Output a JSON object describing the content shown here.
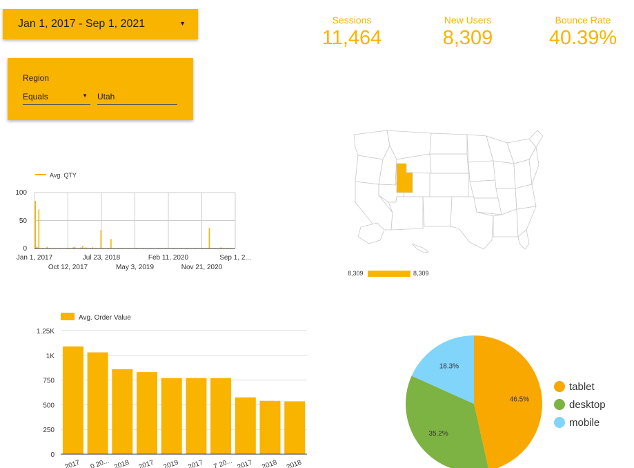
{
  "date_range": {
    "label": "Jan 1, 2017 - Sep 1, 2021",
    "caret_icon": "dropdown-caret-icon"
  },
  "filter": {
    "field_label": "Region",
    "operator": "Equals",
    "value": "Utah"
  },
  "kpis": {
    "sessions": {
      "label": "Sessions",
      "value": "11,464"
    },
    "new_users": {
      "label": "New Users",
      "value": "8,309"
    },
    "bounce_rate": {
      "label": "Bounce Rate",
      "value": "40.39%"
    }
  },
  "colors": {
    "accent": "#f9b400",
    "pie_desktop": "#7cb342",
    "pie_mobile": "#81d4fa",
    "map_fill": "#ffffff"
  },
  "map": {
    "highlighted_region": "Utah",
    "legend_min": "8,309",
    "legend_max": "8,309"
  },
  "chart_data": [
    {
      "type": "bar",
      "legend": "Avg. QTY",
      "xlabels_top": [
        "Jan 1, 2017",
        "Jul 23, 2018",
        "Feb 11, 2020",
        "Sep 1, 2..."
      ],
      "xlabels_bottom": [
        "Oct 12, 2017",
        "May 3, 2019",
        "Nov 21, 2020"
      ],
      "yticks": [
        "0",
        "50",
        "100"
      ],
      "ylim": [
        0,
        100
      ],
      "x_range": [
        "2017-01-01",
        "2021-09-01"
      ],
      "points": [
        {
          "x": "2017-01-04",
          "y": 85
        },
        {
          "x": "2017-01-09",
          "y": 3
        },
        {
          "x": "2017-01-20",
          "y": 2
        },
        {
          "x": "2017-02-02",
          "y": 70
        },
        {
          "x": "2017-03-04",
          "y": 1
        },
        {
          "x": "2017-04-14",
          "y": 3
        },
        {
          "x": "2017-05-04",
          "y": 1
        },
        {
          "x": "2017-06-16",
          "y": 1
        },
        {
          "x": "2017-07-31",
          "y": 1
        },
        {
          "x": "2017-09-04",
          "y": 1
        },
        {
          "x": "2017-09-30",
          "y": 1
        },
        {
          "x": "2017-10-16",
          "y": 1
        },
        {
          "x": "2017-11-22",
          "y": 2
        },
        {
          "x": "2017-12-04",
          "y": 3
        },
        {
          "x": "2018-01-07",
          "y": 1
        },
        {
          "x": "2018-01-24",
          "y": 2
        },
        {
          "x": "2018-02-10",
          "y": 5
        },
        {
          "x": "2018-03-10",
          "y": 2
        },
        {
          "x": "2018-04-13",
          "y": 1
        },
        {
          "x": "2018-05-05",
          "y": 2
        },
        {
          "x": "2018-06-02",
          "y": 1
        },
        {
          "x": "2018-07-14",
          "y": 33
        },
        {
          "x": "2018-08-02",
          "y": 1
        },
        {
          "x": "2018-09-14",
          "y": 1
        },
        {
          "x": "2018-10-08",
          "y": 17
        },
        {
          "x": "2018-11-04",
          "y": 1
        },
        {
          "x": "2018-12-07",
          "y": 1
        },
        {
          "x": "2019-01-09",
          "y": 1
        },
        {
          "x": "2019-03-03",
          "y": 1
        },
        {
          "x": "2019-05-12",
          "y": 1
        },
        {
          "x": "2019-07-10",
          "y": 1
        },
        {
          "x": "2019-09-04",
          "y": 1
        },
        {
          "x": "2019-11-18",
          "y": 1
        },
        {
          "x": "2020-01-17",
          "y": 1
        },
        {
          "x": "2020-03-21",
          "y": 1
        },
        {
          "x": "2020-05-29",
          "y": 1
        },
        {
          "x": "2020-07-15",
          "y": 1
        },
        {
          "x": "2020-09-21",
          "y": 1
        },
        {
          "x": "2020-11-24",
          "y": 1
        },
        {
          "x": "2020-12-27",
          "y": 1
        },
        {
          "x": "2021-01-19",
          "y": 37
        },
        {
          "x": "2021-02-25",
          "y": 1
        },
        {
          "x": "2021-03-16",
          "y": 1
        },
        {
          "x": "2021-04-28",
          "y": 2
        },
        {
          "x": "2021-05-23",
          "y": 1
        },
        {
          "x": "2021-06-18",
          "y": 1
        },
        {
          "x": "2021-07-24",
          "y": 1
        }
      ]
    },
    {
      "type": "bar",
      "legend": "Avg. Order Value",
      "categories": [
        "2017",
        "...0 20...",
        "2018",
        "2017",
        "2019",
        "2017",
        "...7 20...",
        "2017",
        "2018",
        "2018"
      ],
      "values": [
        1090,
        1030,
        860,
        830,
        770,
        770,
        770,
        575,
        540,
        535
      ],
      "yticks": [
        "0",
        "250",
        "500",
        "750",
        "1K",
        "1.25K"
      ],
      "ylim": [
        0,
        1250
      ]
    },
    {
      "type": "pie",
      "slices": [
        {
          "label": "tablet",
          "value": 46.5,
          "display": "46.5%",
          "color": "#f9a800"
        },
        {
          "label": "desktop",
          "value": 35.2,
          "display": "35.2%",
          "color": "#7cb342"
        },
        {
          "label": "mobile",
          "value": 18.3,
          "display": "18.3%",
          "color": "#81d4fa"
        }
      ]
    }
  ]
}
